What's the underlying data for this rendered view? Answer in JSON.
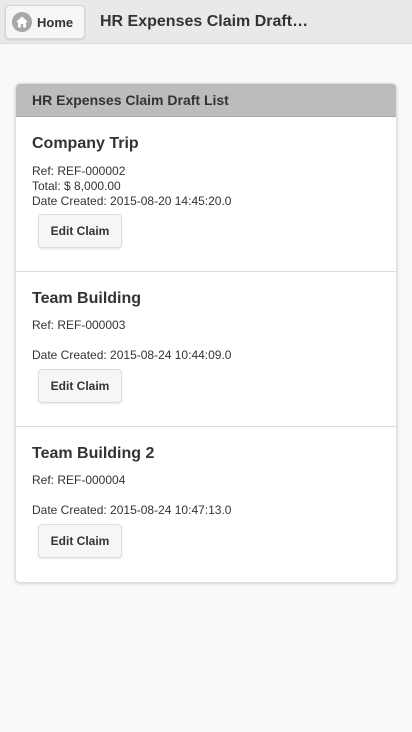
{
  "header": {
    "home_label": "Home",
    "home_icon": "home-icon",
    "title": "HR Expenses Claim Draft List"
  },
  "panel": {
    "title": "HR Expenses Claim Draft List"
  },
  "claims": [
    {
      "title": "Company Trip",
      "ref": "Ref: REF-000002",
      "total": "Total: $ 8,000.00",
      "date": "Date Created: 2015-08-20 14:45:20.0",
      "button": "Edit Claim"
    },
    {
      "title": "Team Building",
      "ref": "Ref: REF-000003",
      "total": "",
      "date": "Date Created: 2015-08-24 10:44:09.0",
      "button": "Edit Claim"
    },
    {
      "title": "Team Building 2",
      "ref": "Ref: REF-000004",
      "total": "",
      "date": "Date Created: 2015-08-24 10:47:13.0",
      "button": "Edit Claim"
    }
  ]
}
